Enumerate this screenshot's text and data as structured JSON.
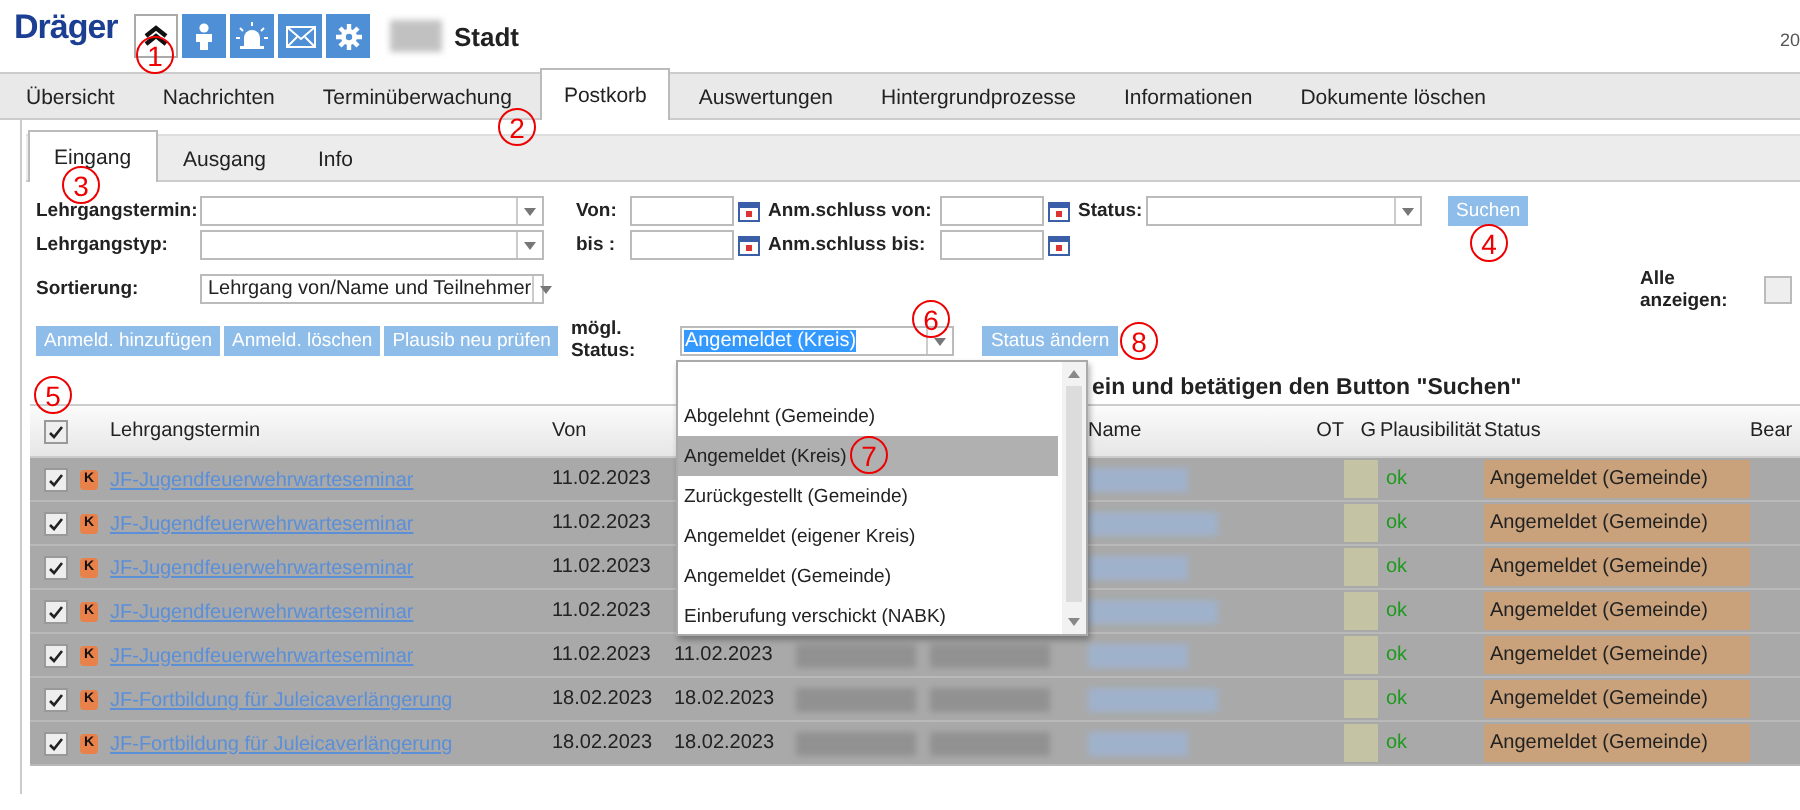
{
  "header": {
    "logo": "Dräger",
    "icon_buttons": [
      {
        "selected": true
      },
      {
        "selected": false
      },
      {
        "selected": false
      },
      {
        "selected": false
      },
      {
        "selected": false
      }
    ],
    "place": "Stadt",
    "date": "20"
  },
  "main_tabs": [
    {
      "label": "Übersicht",
      "selected": false
    },
    {
      "label": "Nachrichten",
      "selected": false
    },
    {
      "label": "Terminüberwachung",
      "selected": false
    },
    {
      "label": "Postkorb",
      "selected": true
    },
    {
      "label": "Auswertungen",
      "selected": false
    },
    {
      "label": "Hintergrundprozesse",
      "selected": false
    },
    {
      "label": "Informationen",
      "selected": false
    },
    {
      "label": "Dokumente löschen",
      "selected": false
    }
  ],
  "sub_tabs": [
    {
      "label": "Eingang",
      "selected": true
    },
    {
      "label": "Ausgang",
      "selected": false
    },
    {
      "label": "Info",
      "selected": false
    }
  ],
  "filters": {
    "lehrgangstermin": {
      "label": "Lehrgangstermin:"
    },
    "lehrgangstyp": {
      "label": "Lehrgangstyp:"
    },
    "sortierung": {
      "label": "Sortierung:",
      "value": "Lehrgang von/Name und Teilnehmer"
    },
    "von": {
      "label": "Von:"
    },
    "bis": {
      "label": "bis :"
    },
    "anm_von": {
      "label": "Anm.schluss von:"
    },
    "anm_bis": {
      "label": "Anm.schluss bis:"
    },
    "status": {
      "label": "Status:"
    },
    "search_button": "Suchen",
    "show_all": {
      "label": "Alle anzeigen:",
      "checked": false
    }
  },
  "actions": {
    "buttons": [
      "Anmeld. hinzufügen",
      "Anmeld. löschen",
      "Plausib neu prüfen"
    ],
    "status_label": "mögl. Status:",
    "status_value": "Angemeldet (Kreis)",
    "change_button": "Status ändern"
  },
  "status_options": [
    {
      "label": "Abgelehnt (Gemeinde)",
      "selected": false
    },
    {
      "label": "Angemeldet (Kreis)",
      "selected": true
    },
    {
      "label": "Zurückgestellt (Gemeinde)",
      "selected": false
    },
    {
      "label": "Angemeldet (eigener Kreis)",
      "selected": false
    },
    {
      "label": "Angemeldet (Gemeinde)",
      "selected": false
    },
    {
      "label": "Einberufung verschickt (NABK)",
      "selected": false
    }
  ],
  "hint": "ein und betätigen den Button \"Suchen\"",
  "table": {
    "all_checked": true,
    "columns": [
      "Lehrgangstermin",
      "Von",
      "Name",
      "OT",
      "G",
      "Plausibilität",
      "Status",
      "Bear"
    ],
    "rows": [
      {
        "checked": true,
        "badge": "K",
        "termin": "JF-Jugendfeuerwehrwarteseminar",
        "von": "11.02.2023",
        "plausibility": "ok",
        "status": "Angemeldet (Gemeinde)"
      },
      {
        "checked": true,
        "badge": "K",
        "termin": "JF-Jugendfeuerwehrwarteseminar",
        "von": "11.02.2023",
        "plausibility": "ok",
        "status": "Angemeldet (Gemeinde)"
      },
      {
        "checked": true,
        "badge": "K",
        "termin": "JF-Jugendfeuerwehrwarteseminar",
        "von": "11.02.2023",
        "plausibility": "ok",
        "status": "Angemeldet (Gemeinde)"
      },
      {
        "checked": true,
        "badge": "K",
        "termin": "JF-Jugendfeuerwehrwarteseminar",
        "von": "11.02.2023",
        "plausibility": "ok",
        "status": "Angemeldet (Gemeinde)"
      },
      {
        "checked": true,
        "badge": "K",
        "termin": "JF-Jugendfeuerwehrwarteseminar",
        "von": "11.02.2023",
        "bis": "11.02.2023",
        "plausibility": "ok",
        "status": "Angemeldet (Gemeinde)"
      },
      {
        "checked": true,
        "badge": "K",
        "termin": "JF-Fortbildung für Juleicaverlängerung",
        "von": "18.02.2023",
        "bis": "18.02.2023",
        "plausibility": "ok",
        "status": "Angemeldet (Gemeinde)"
      },
      {
        "checked": true,
        "badge": "K",
        "termin": "JF-Fortbildung für Juleicaverlängerung",
        "von": "18.02.2023",
        "bis": "18.02.2023",
        "plausibility": "ok",
        "status": "Angemeldet (Gemeinde)"
      }
    ]
  },
  "annotations": [
    "1",
    "2",
    "3",
    "4",
    "5",
    "6",
    "7",
    "8"
  ]
}
